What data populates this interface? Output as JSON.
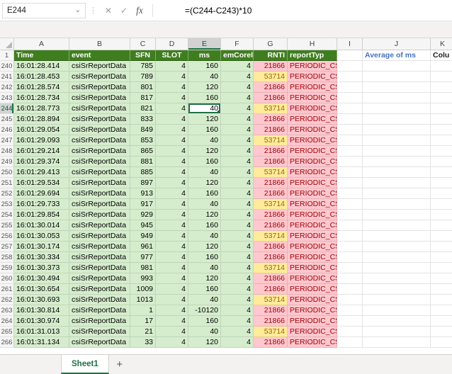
{
  "formula_bar": {
    "name_box": "E244",
    "formula": "=(C244-C243)*10",
    "fx_label": "fx",
    "cancel_label": "✕",
    "enter_label": "✓"
  },
  "icons": {
    "name_box_chevron": "⌄",
    "drag_dots": "⋮"
  },
  "column_letters": [
    "A",
    "B",
    "C",
    "D",
    "E",
    "F",
    "G",
    "H",
    "I",
    "J",
    "K"
  ],
  "selection": {
    "active_cell": "E244",
    "active_row": "244",
    "active_col": "E"
  },
  "header_row": {
    "row_number": "1",
    "time": "Time",
    "event": "event",
    "sfn": "SFN",
    "slot": "SLOT",
    "ms": "ms",
    "emcoreid": "emCoreld",
    "rnti": "RNTI",
    "report": "reportTyp",
    "col_i": "",
    "col_j": "Average of ms",
    "col_k": "Colu"
  },
  "rows": [
    {
      "n": "240",
      "time": "16:01:28.414",
      "event": "csiSrReportData",
      "sfn": "785",
      "slot": "4",
      "ms": "160",
      "emcoreid": "4",
      "rnti": "21866",
      "rnti_style": "bad",
      "report": "PERIODIC_CSI"
    },
    {
      "n": "241",
      "time": "16:01:28.453",
      "event": "csiSrReportData",
      "sfn": "789",
      "slot": "4",
      "ms": "40",
      "emcoreid": "4",
      "rnti": "53714",
      "rnti_style": "neutral",
      "report": "PERIODIC_CSI"
    },
    {
      "n": "242",
      "time": "16:01:28.574",
      "event": "csiSrReportData",
      "sfn": "801",
      "slot": "4",
      "ms": "120",
      "emcoreid": "4",
      "rnti": "21866",
      "rnti_style": "bad",
      "report": "PERIODIC_CSI"
    },
    {
      "n": "243",
      "time": "16:01:28.734",
      "event": "csiSrReportData",
      "sfn": "817",
      "slot": "4",
      "ms": "160",
      "emcoreid": "4",
      "rnti": "21866",
      "rnti_style": "bad",
      "report": "PERIODIC_CSI"
    },
    {
      "n": "244",
      "time": "16:01:28.773",
      "event": "csiSrReportData",
      "sfn": "821",
      "slot": "4",
      "ms": "40",
      "emcoreid": "4",
      "rnti": "53714",
      "rnti_style": "neutral",
      "report": "PERIODIC_CSI"
    },
    {
      "n": "245",
      "time": "16:01:28.894",
      "event": "csiSrReportData",
      "sfn": "833",
      "slot": "4",
      "ms": "120",
      "emcoreid": "4",
      "rnti": "21866",
      "rnti_style": "bad",
      "report": "PERIODIC_CSI"
    },
    {
      "n": "246",
      "time": "16:01:29.054",
      "event": "csiSrReportData",
      "sfn": "849",
      "slot": "4",
      "ms": "160",
      "emcoreid": "4",
      "rnti": "21866",
      "rnti_style": "bad",
      "report": "PERIODIC_CSI"
    },
    {
      "n": "247",
      "time": "16:01:29.093",
      "event": "csiSrReportData",
      "sfn": "853",
      "slot": "4",
      "ms": "40",
      "emcoreid": "4",
      "rnti": "53714",
      "rnti_style": "neutral",
      "report": "PERIODIC_CSI"
    },
    {
      "n": "248",
      "time": "16:01:29.214",
      "event": "csiSrReportData",
      "sfn": "865",
      "slot": "4",
      "ms": "120",
      "emcoreid": "4",
      "rnti": "21866",
      "rnti_style": "bad",
      "report": "PERIODIC_CSI"
    },
    {
      "n": "249",
      "time": "16:01:29.374",
      "event": "csiSrReportData",
      "sfn": "881",
      "slot": "4",
      "ms": "160",
      "emcoreid": "4",
      "rnti": "21866",
      "rnti_style": "bad",
      "report": "PERIODIC_CSI"
    },
    {
      "n": "250",
      "time": "16:01:29.413",
      "event": "csiSrReportData",
      "sfn": "885",
      "slot": "4",
      "ms": "40",
      "emcoreid": "4",
      "rnti": "53714",
      "rnti_style": "neutral",
      "report": "PERIODIC_CSI"
    },
    {
      "n": "251",
      "time": "16:01:29.534",
      "event": "csiSrReportData",
      "sfn": "897",
      "slot": "4",
      "ms": "120",
      "emcoreid": "4",
      "rnti": "21866",
      "rnti_style": "bad",
      "report": "PERIODIC_CSI"
    },
    {
      "n": "252",
      "time": "16:01:29.694",
      "event": "csiSrReportData",
      "sfn": "913",
      "slot": "4",
      "ms": "160",
      "emcoreid": "4",
      "rnti": "21866",
      "rnti_style": "bad",
      "report": "PERIODIC_CSI"
    },
    {
      "n": "253",
      "time": "16:01:29.733",
      "event": "csiSrReportData",
      "sfn": "917",
      "slot": "4",
      "ms": "40",
      "emcoreid": "4",
      "rnti": "53714",
      "rnti_style": "neutral",
      "report": "PERIODIC_CSI"
    },
    {
      "n": "254",
      "time": "16:01:29.854",
      "event": "csiSrReportData",
      "sfn": "929",
      "slot": "4",
      "ms": "120",
      "emcoreid": "4",
      "rnti": "21866",
      "rnti_style": "bad",
      "report": "PERIODIC_CSI"
    },
    {
      "n": "255",
      "time": "16:01:30.014",
      "event": "csiSrReportData",
      "sfn": "945",
      "slot": "4",
      "ms": "160",
      "emcoreid": "4",
      "rnti": "21866",
      "rnti_style": "bad",
      "report": "PERIODIC_CSI"
    },
    {
      "n": "256",
      "time": "16:01:30.053",
      "event": "csiSrReportData",
      "sfn": "949",
      "slot": "4",
      "ms": "40",
      "emcoreid": "4",
      "rnti": "53714",
      "rnti_style": "neutral",
      "report": "PERIODIC_CSI"
    },
    {
      "n": "257",
      "time": "16:01:30.174",
      "event": "csiSrReportData",
      "sfn": "961",
      "slot": "4",
      "ms": "120",
      "emcoreid": "4",
      "rnti": "21866",
      "rnti_style": "bad",
      "report": "PERIODIC_CSI"
    },
    {
      "n": "258",
      "time": "16:01:30.334",
      "event": "csiSrReportData",
      "sfn": "977",
      "slot": "4",
      "ms": "160",
      "emcoreid": "4",
      "rnti": "21866",
      "rnti_style": "bad",
      "report": "PERIODIC_CSI"
    },
    {
      "n": "259",
      "time": "16:01:30.373",
      "event": "csiSrReportData",
      "sfn": "981",
      "slot": "4",
      "ms": "40",
      "emcoreid": "4",
      "rnti": "53714",
      "rnti_style": "neutral",
      "report": "PERIODIC_CSI"
    },
    {
      "n": "260",
      "time": "16:01:30.494",
      "event": "csiSrReportData",
      "sfn": "993",
      "slot": "4",
      "ms": "120",
      "emcoreid": "4",
      "rnti": "21866",
      "rnti_style": "bad",
      "report": "PERIODIC_CSI"
    },
    {
      "n": "261",
      "time": "16:01:30.654",
      "event": "csiSrReportData",
      "sfn": "1009",
      "slot": "4",
      "ms": "160",
      "emcoreid": "4",
      "rnti": "21866",
      "rnti_style": "bad",
      "report": "PERIODIC_CSI"
    },
    {
      "n": "262",
      "time": "16:01:30.693",
      "event": "csiSrReportData",
      "sfn": "1013",
      "slot": "4",
      "ms": "40",
      "emcoreid": "4",
      "rnti": "53714",
      "rnti_style": "neutral",
      "report": "PERIODIC_CSI"
    },
    {
      "n": "263",
      "time": "16:01:30.814",
      "event": "csiSrReportData",
      "sfn": "1",
      "slot": "4",
      "ms": "-10120",
      "emcoreid": "4",
      "rnti": "21866",
      "rnti_style": "bad",
      "report": "PERIODIC_CSI"
    },
    {
      "n": "264",
      "time": "16:01:30.974",
      "event": "csiSrReportData",
      "sfn": "17",
      "slot": "4",
      "ms": "160",
      "emcoreid": "4",
      "rnti": "21866",
      "rnti_style": "bad",
      "report": "PERIODIC_CSI"
    },
    {
      "n": "265",
      "time": "16:01:31.013",
      "event": "csiSrReportData",
      "sfn": "21",
      "slot": "4",
      "ms": "40",
      "emcoreid": "4",
      "rnti": "53714",
      "rnti_style": "neutral",
      "report": "PERIODIC_CSI"
    },
    {
      "n": "266",
      "time": "16:01:31.134",
      "event": "csiSrReportData",
      "sfn": "33",
      "slot": "4",
      "ms": "120",
      "emcoreid": "4",
      "rnti": "21866",
      "rnti_style": "bad",
      "report": "PERIODIC_CSI"
    }
  ],
  "sheet_tabs": {
    "tabs": [
      "Sheet1"
    ],
    "add_label": "+"
  },
  "colors": {
    "header_green": "#3f7e1e",
    "data_green": "#d6edcd",
    "bad_bg": "#ffc7ce",
    "bad_text": "#9c0006",
    "neutral_bg": "#ffeb9c",
    "neutral_text": "#9c6500",
    "selection_green": "#1e7145",
    "pivot_blue": "#4472c4"
  }
}
